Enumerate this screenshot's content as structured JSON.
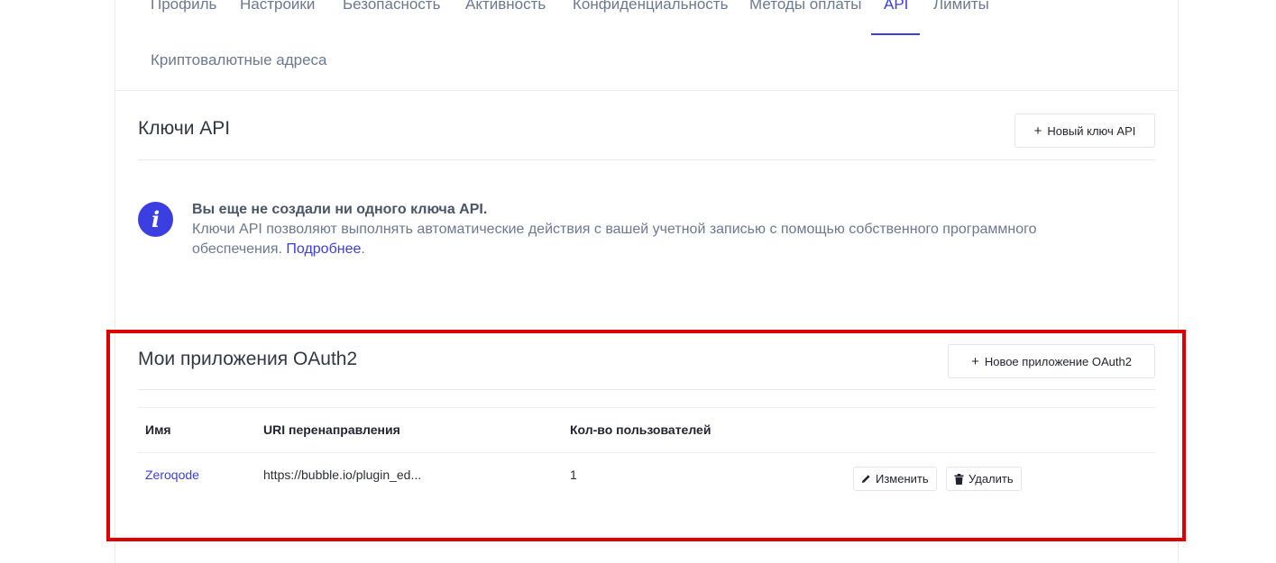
{
  "tabs": [
    {
      "label": "Профиль"
    },
    {
      "label": "Настройки"
    },
    {
      "label": "Безопасность"
    },
    {
      "label": "Активность"
    },
    {
      "label": "Конфиденциальность"
    },
    {
      "label": "Методы оплаты"
    },
    {
      "label": "API",
      "active": true
    },
    {
      "label": "Лимиты"
    },
    {
      "label": "Криптовалютные адреса"
    }
  ],
  "api_keys": {
    "title": "Ключи API",
    "new_button": "Новый ключ API",
    "notice_title": "Вы еще не создали ни одного ключа API.",
    "notice_body": "Ключи API позволяют выполнять автоматические действия с вашей учетной записью с помощью собственного программного обеспечения.",
    "notice_link": "Подробнее",
    "notice_link_suffix": "."
  },
  "oauth": {
    "title": "Мои приложения OAuth2",
    "new_button": "Новое приложение OAuth2",
    "columns": [
      "Имя",
      "URI перенаправления",
      "Кол-во пользователей"
    ],
    "rows": [
      {
        "name": "Zeroqode",
        "uri": "https://bubble.io/plugin_ed...",
        "users": "1",
        "edit_label": "Изменить",
        "delete_label": "Удалить"
      }
    ]
  },
  "colors": {
    "accent": "#3b3ee0",
    "highlight": "#e00000",
    "muted_text": "#6b7a90"
  },
  "icons": {
    "info": "info-icon",
    "plus": "plus-icon",
    "edit": "pencil-icon",
    "delete": "trash-icon"
  }
}
